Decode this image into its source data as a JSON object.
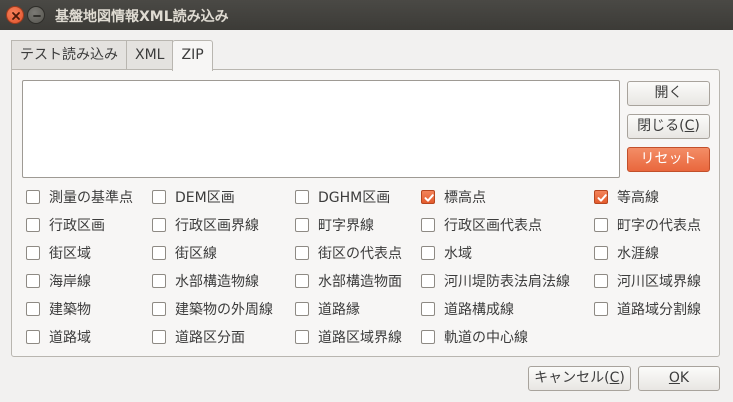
{
  "window": {
    "title": "基盤地図情報XML読み込み"
  },
  "tabs": [
    {
      "label": "テスト読み込み",
      "active": false
    },
    {
      "label": "XML",
      "active": false
    },
    {
      "label": "ZIP",
      "active": true
    }
  ],
  "textarea": {
    "value": ""
  },
  "buttons": {
    "open": "開く",
    "close_pre": "閉じる(",
    "close_mnemonic": "C",
    "close_post": ")",
    "reset": "リセット",
    "cancel_pre": "キャンセル(",
    "cancel_mnemonic": "C",
    "cancel_post": ")",
    "ok_mnemonic": "O",
    "ok_post": "K"
  },
  "checkboxes": [
    [
      {
        "label": "測量の基準点",
        "checked": false
      },
      {
        "label": "DEM区画",
        "checked": false
      },
      {
        "label": "DGHM区画",
        "checked": false
      },
      {
        "label": "標高点",
        "checked": true
      },
      {
        "label": "等高線",
        "checked": true
      }
    ],
    [
      {
        "label": "行政区画",
        "checked": false
      },
      {
        "label": "行政区画界線",
        "checked": false
      },
      {
        "label": "町字界線",
        "checked": false
      },
      {
        "label": "行政区画代表点",
        "checked": false
      },
      {
        "label": "町字の代表点",
        "checked": false
      }
    ],
    [
      {
        "label": "街区域",
        "checked": false
      },
      {
        "label": "街区線",
        "checked": false
      },
      {
        "label": "街区の代表点",
        "checked": false
      },
      {
        "label": "水域",
        "checked": false
      },
      {
        "label": "水涯線",
        "checked": false
      }
    ],
    [
      {
        "label": "海岸線",
        "checked": false
      },
      {
        "label": "水部構造物線",
        "checked": false
      },
      {
        "label": "水部構造物面",
        "checked": false
      },
      {
        "label": "河川堤防表法肩法線",
        "checked": false
      },
      {
        "label": "河川区域界線",
        "checked": false
      }
    ],
    [
      {
        "label": "建築物",
        "checked": false
      },
      {
        "label": "建築物の外周線",
        "checked": false
      },
      {
        "label": "道路縁",
        "checked": false
      },
      {
        "label": "道路構成線",
        "checked": false
      },
      {
        "label": "道路域分割線",
        "checked": false
      }
    ],
    [
      {
        "label": "道路域",
        "checked": false
      },
      {
        "label": "道路区分面",
        "checked": false
      },
      {
        "label": "道路区域界線",
        "checked": false
      },
      {
        "label": "軌道の中心線",
        "checked": false
      }
    ]
  ],
  "colors": {
    "accent": "#e9673d",
    "titlebar": "#3c3b37"
  },
  "icons": {
    "close": "close-icon",
    "minimize": "minimize-icon",
    "check": "check-icon"
  }
}
